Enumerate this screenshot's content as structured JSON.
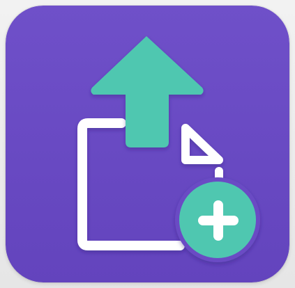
{
  "app_icon": {
    "icon_name": "upload-file-add-icon",
    "colors": {
      "tile": "#6a4bc4",
      "tile_edge": "#5a3db3",
      "arrow": "#4fc7b0",
      "document_outline": "#ffffff",
      "plus_badge": "#4fc7b0",
      "plus_sign": "#ffffff",
      "background": "#ececec"
    },
    "parts": {
      "upload_arrow": "arrow-up-icon",
      "document": "document-icon",
      "badge": "plus-icon"
    }
  }
}
